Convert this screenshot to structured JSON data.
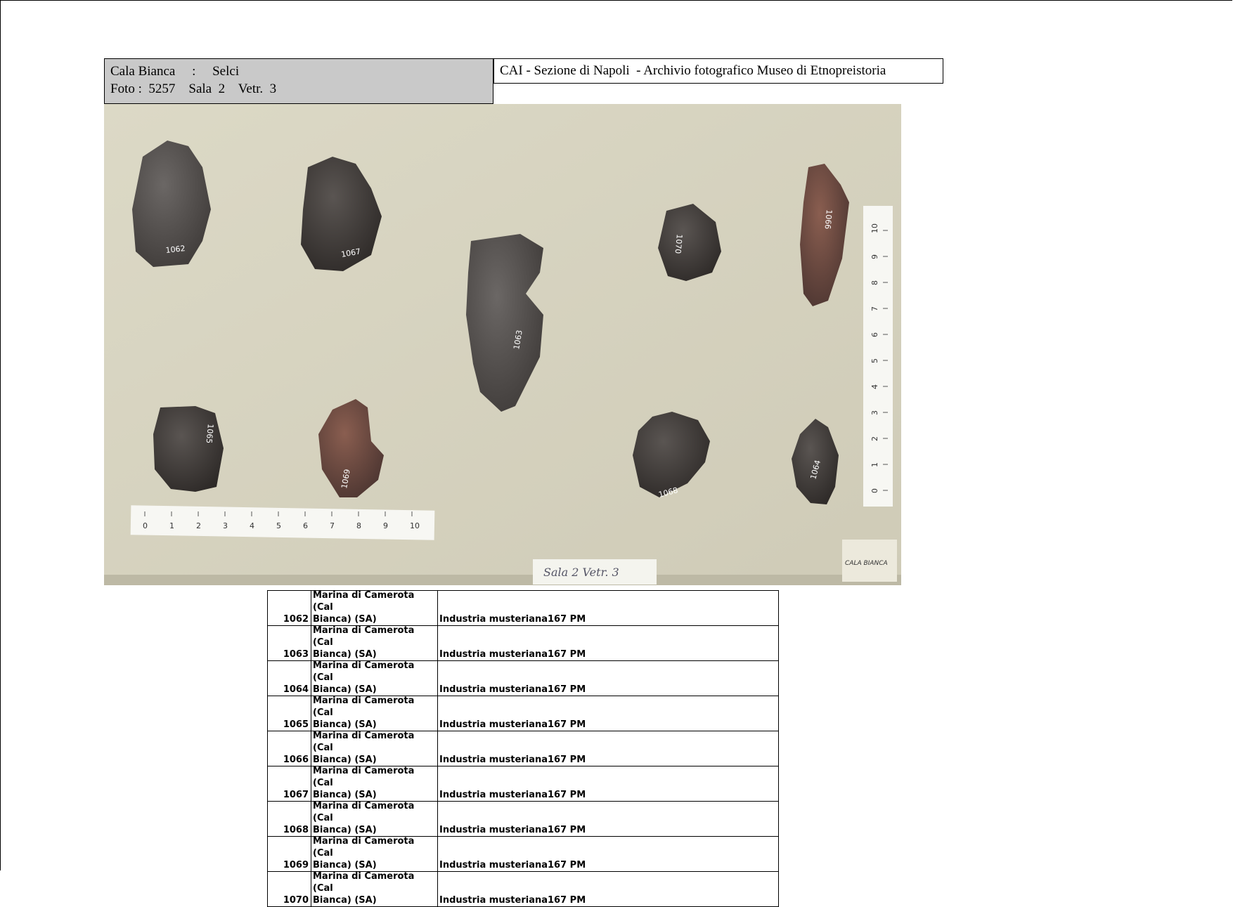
{
  "header": {
    "site": "Cala Bianca",
    "sep": ":",
    "material": "Selci",
    "foto_label": "Foto :",
    "foto_num": "5257",
    "sala": "Sala  2",
    "vetrina": "Vetr.  3",
    "archive_title": "CAI - Sezione di Napoli  - Archivio fotografico Museo di Etnopreistoria"
  },
  "photo": {
    "labels": [
      "1062",
      "1067",
      "1063",
      "1070",
      "1066",
      "1065",
      "1069",
      "1068",
      "1064"
    ],
    "ruler_h_ticks": [
      "0",
      "1",
      "2",
      "3",
      "4",
      "5",
      "6",
      "7",
      "8",
      "9",
      "10"
    ],
    "ruler_v_ticks": [
      "0",
      "1",
      "2",
      "3",
      "4",
      "5",
      "6",
      "7",
      "8",
      "9",
      "10"
    ],
    "card_label": "Sala 2  Vetr. 3",
    "tag_label": "CALA BIANCA"
  },
  "catalog": [
    {
      "num": "1062",
      "loc1": "Marina di Camerota (Cal",
      "loc2": "Bianca) (SA)",
      "industry": "Industria musteriana",
      "period": "167 PM"
    },
    {
      "num": "1063",
      "loc1": "Marina di Camerota (Cal",
      "loc2": "Bianca) (SA)",
      "industry": "Industria musteriana",
      "period": "167 PM"
    },
    {
      "num": "1064",
      "loc1": "Marina di Camerota (Cal",
      "loc2": "Bianca) (SA)",
      "industry": "Industria musteriana",
      "period": "167 PM"
    },
    {
      "num": "1065",
      "loc1": "Marina di Camerota (Cal",
      "loc2": "Bianca) (SA)",
      "industry": "Industria musteriana",
      "period": "167 PM"
    },
    {
      "num": "1066",
      "loc1": "Marina di Camerota (Cal",
      "loc2": "Bianca) (SA)",
      "industry": "Industria musteriana",
      "period": "167 PM"
    },
    {
      "num": "1067",
      "loc1": "Marina di Camerota (Cal",
      "loc2": "Bianca) (SA)",
      "industry": "Industria musteriana",
      "period": "167 PM"
    },
    {
      "num": "1068",
      "loc1": "Marina di Camerota (Cal",
      "loc2": "Bianca) (SA)",
      "industry": "Industria musteriana",
      "period": "167 PM"
    },
    {
      "num": "1069",
      "loc1": "Marina di Camerota (Cal",
      "loc2": "Bianca) (SA)",
      "industry": "Industria musteriana",
      "period": "167 PM"
    },
    {
      "num": "1070",
      "loc1": "Marina di Camerota (Cal",
      "loc2": "Bianca) (SA)",
      "industry": "Industria musteriana",
      "period": "167 PM"
    }
  ],
  "colors": {
    "header_bg": "#c9c9c9",
    "board": "#d8d5c2",
    "stone_dark": "#3a3533",
    "stone_reddish": "#6a4a40"
  }
}
